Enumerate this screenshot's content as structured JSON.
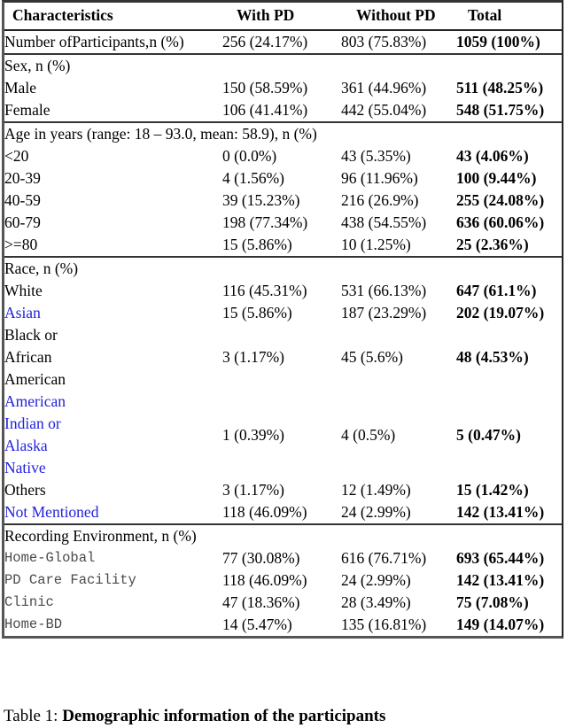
{
  "table": {
    "columns": [
      "Characteristics",
      "With PD",
      "Without PD",
      "Total"
    ],
    "accent_blue": "#2222dd",
    "sections": [
      {
        "id": "participants",
        "heading": null,
        "rows": [
          {
            "label_lines": [
              "Number of",
              "Participants,",
              "n (%)"
            ],
            "style": "group",
            "with_pd": "256 (24.17%)",
            "without_pd": "803 (75.83%)",
            "total": "1059 (100%)"
          }
        ]
      },
      {
        "id": "sex",
        "heading": "Sex, n (%)",
        "rows": [
          {
            "label_lines": [
              "Male"
            ],
            "style": "item",
            "with_pd": "150 (58.59%)",
            "without_pd": "361 (44.96%)",
            "total": "511 (48.25%)"
          },
          {
            "label_lines": [
              "Female"
            ],
            "style": "item",
            "with_pd": "106 (41.41%)",
            "without_pd": "442 (55.04%)",
            "total": "548 (51.75%)"
          }
        ]
      },
      {
        "id": "age",
        "heading": "Age in years (range: 18 – 93.0, mean: 58.9), n (%)",
        "rows": [
          {
            "label_lines": [
              "<20"
            ],
            "style": "item",
            "with_pd": "0 (0.0%)",
            "without_pd": "43 (5.35%)",
            "total": "43 (4.06%)"
          },
          {
            "label_lines": [
              "20-39"
            ],
            "style": "item",
            "with_pd": "4 (1.56%)",
            "without_pd": "96 (11.96%)",
            "total": "100 (9.44%)"
          },
          {
            "label_lines": [
              "40-59"
            ],
            "style": "item",
            "with_pd": "39 (15.23%)",
            "without_pd": "216 (26.9%)",
            "total": "255 (24.08%)"
          },
          {
            "label_lines": [
              "60-79"
            ],
            "style": "item",
            "with_pd": "198 (77.34%)",
            "without_pd": "438 (54.55%)",
            "total": "636 (60.06%)"
          },
          {
            "label_lines": [
              ">=80"
            ],
            "style": "item",
            "with_pd": "15 (5.86%)",
            "without_pd": "10 (1.25%)",
            "total": "25 (2.36%)"
          }
        ]
      },
      {
        "id": "race",
        "heading": "Race, n (%)",
        "rows": [
          {
            "label_lines": [
              "White"
            ],
            "style": "item",
            "with_pd": "116 (45.31%)",
            "without_pd": "531 (66.13%)",
            "total": "647 (61.1%)"
          },
          {
            "label_lines": [
              "Asian"
            ],
            "style": "item",
            "color": "blue",
            "with_pd": "15 (5.86%)",
            "without_pd": "187 (23.29%)",
            "total": "202 (19.07%)"
          },
          {
            "label_lines": [
              "Black or",
              "African",
              "American"
            ],
            "style": "item",
            "with_pd": "3 (1.17%)",
            "without_pd": "45 (5.6%)",
            "total": "48 (4.53%)"
          },
          {
            "label_lines": [
              "American",
              "Indian or",
              "Alaska",
              "Native"
            ],
            "style": "item",
            "color": "blue",
            "with_pd": "1 (0.39%)",
            "without_pd": "4 (0.5%)",
            "total": "5 (0.47%)"
          },
          {
            "label_lines": [
              "Others"
            ],
            "style": "item",
            "with_pd": "3 (1.17%)",
            "without_pd": "12 (1.49%)",
            "total": "15 (1.42%)"
          },
          {
            "label_lines": [
              "Not Mentioned"
            ],
            "style": "item",
            "color": "blue",
            "with_pd": "118 (46.09%)",
            "without_pd": "24 (2.99%)",
            "total": "142 (13.41%)"
          }
        ]
      },
      {
        "id": "recording-environment",
        "heading": "Recording Environment, n (%)",
        "rows": [
          {
            "label_lines": [
              "Home-Global"
            ],
            "style": "item",
            "font": "mono",
            "with_pd": "77 (30.08%)",
            "without_pd": "616 (76.71%)",
            "total": "693 (65.44%)"
          },
          {
            "label_lines": [
              "PD Care Facility"
            ],
            "style": "item",
            "font": "mono",
            "with_pd": "118 (46.09%)",
            "without_pd": "24 (2.99%)",
            "total": "142 (13.41%)"
          },
          {
            "label_lines": [
              "Clinic"
            ],
            "style": "item",
            "font": "mono",
            "with_pd": "47 (18.36%)",
            "without_pd": "28 (3.49%)",
            "total": "75 (7.08%)"
          },
          {
            "label_lines": [
              "Home-BD"
            ],
            "style": "item",
            "font": "mono",
            "with_pd": "14 (5.47%)",
            "without_pd": "135 (16.81%)",
            "total": "149 (14.07%)"
          }
        ]
      }
    ]
  },
  "caption": {
    "number": "Table 1: ",
    "text": "Demographic information of the participants"
  }
}
